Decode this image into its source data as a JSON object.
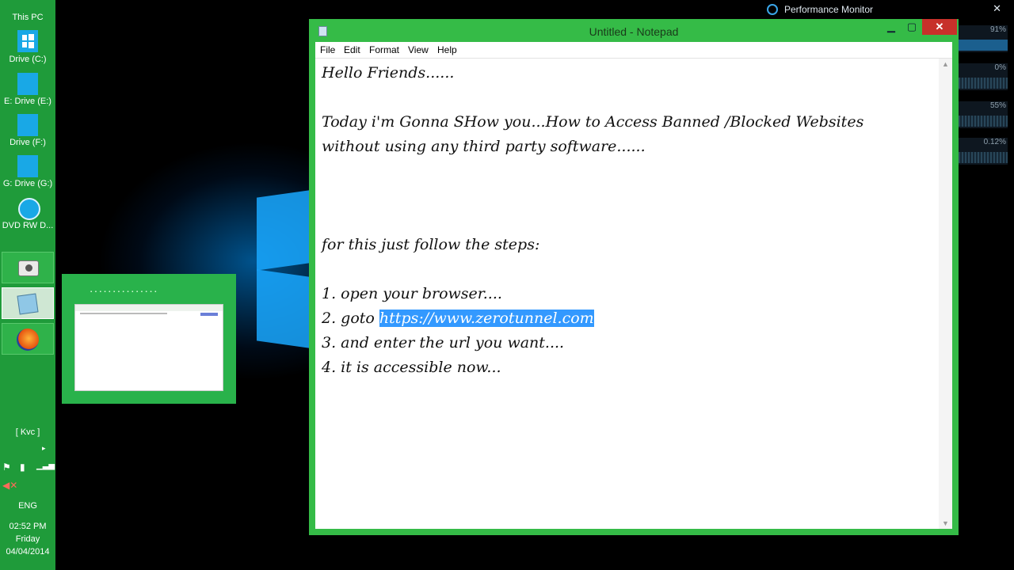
{
  "taskbar": {
    "drives": [
      {
        "label": "This PC"
      },
      {
        "label": "Drive (C:)"
      },
      {
        "label": "E: Drive (E:)"
      },
      {
        "label": "Drive (F:)"
      },
      {
        "label": "G: Drive (G:)"
      },
      {
        "label": "DVD RW D..."
      }
    ],
    "user": "[ Kvc ]",
    "language": "ENG",
    "time": "02:52 PM",
    "day": "Friday",
    "date": "04/04/2014"
  },
  "perf_monitor": {
    "title": "Performance Monitor",
    "values": [
      "91%",
      "0%",
      "55%",
      "0.12%"
    ]
  },
  "notepad": {
    "title": "Untitled - Notepad",
    "menu": [
      "File",
      "Edit",
      "Format",
      "View",
      "Help"
    ],
    "lines": [
      "Hello Friends......",
      "",
      "Today i'm Gonna SHow you...How to Access Banned /Blocked Websites",
      "without using any third party software......",
      "",
      "",
      "",
      "for this just follow the steps:",
      "",
      "1. open your browser....",
      "2. goto ",
      "3. and enter the url you want....",
      "4. it is accessible now..."
    ],
    "selected_url": "https://www.zerotunnel.com"
  },
  "colors": {
    "accent": "#35bb47",
    "taskbar": "#1f9b3a",
    "selection": "#3399ff",
    "close": "#c7312a"
  }
}
